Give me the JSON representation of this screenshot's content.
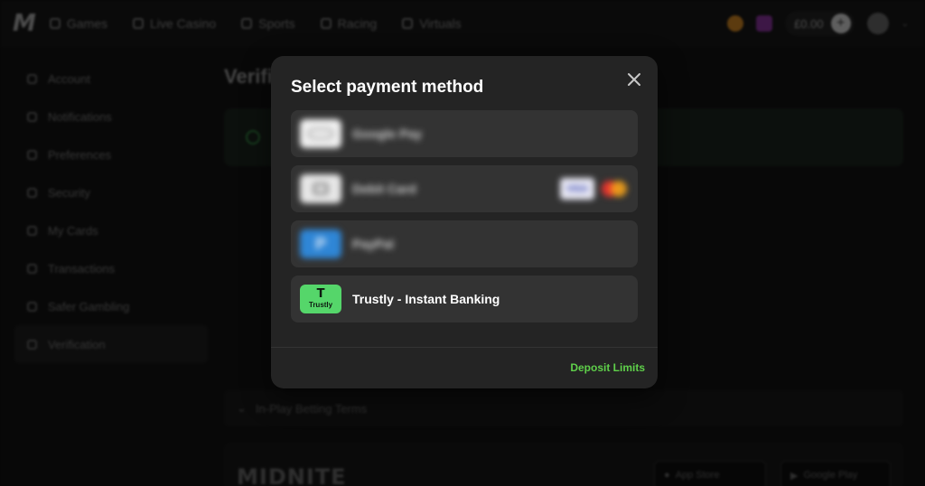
{
  "topbar": {
    "logo": "M",
    "nav": [
      {
        "label": "Games",
        "icon": "games-icon"
      },
      {
        "label": "Live Casino",
        "icon": "live-casino-icon"
      },
      {
        "label": "Sports",
        "icon": "sports-icon"
      },
      {
        "label": "Racing",
        "icon": "racing-icon"
      },
      {
        "label": "Virtuals",
        "icon": "virtuals-icon"
      }
    ],
    "balance": "£0.00",
    "plus_label": "+",
    "user_chevron": "⌄"
  },
  "sidebar": {
    "items": [
      {
        "label": "Account"
      },
      {
        "label": "Notifications"
      },
      {
        "label": "Preferences"
      },
      {
        "label": "Security"
      },
      {
        "label": "My Cards"
      },
      {
        "label": "Transactions"
      },
      {
        "label": "Safer Gambling"
      },
      {
        "label": "Verification"
      }
    ]
  },
  "main": {
    "title": "Verification",
    "terms_label": "In-Play Betting Terms",
    "terms_chevron": "⌄",
    "footer_logo": "MIDNITE",
    "app_store_label": "App Store",
    "google_play_label": "Google Play"
  },
  "modal": {
    "title": "Select payment method",
    "close_symbol": "✕",
    "methods": [
      {
        "label": "Google Pay",
        "logo": "google-pay-logo"
      },
      {
        "label": "Debit Card",
        "logo": "debit-card-logo",
        "brand_visa": "VISA"
      },
      {
        "label": "PayPal",
        "logo": "paypal-logo",
        "logo_text": "P"
      },
      {
        "label": "Trustly - Instant Banking",
        "logo": "trustly-logo",
        "logo_mark": "T",
        "logo_word": "Trustly"
      }
    ],
    "footer_link": "Deposit Limits"
  },
  "colors": {
    "accent_green": "#5fd04a",
    "trustly_green": "#55d66a",
    "modal_bg": "#242424",
    "option_bg": "#333333"
  }
}
